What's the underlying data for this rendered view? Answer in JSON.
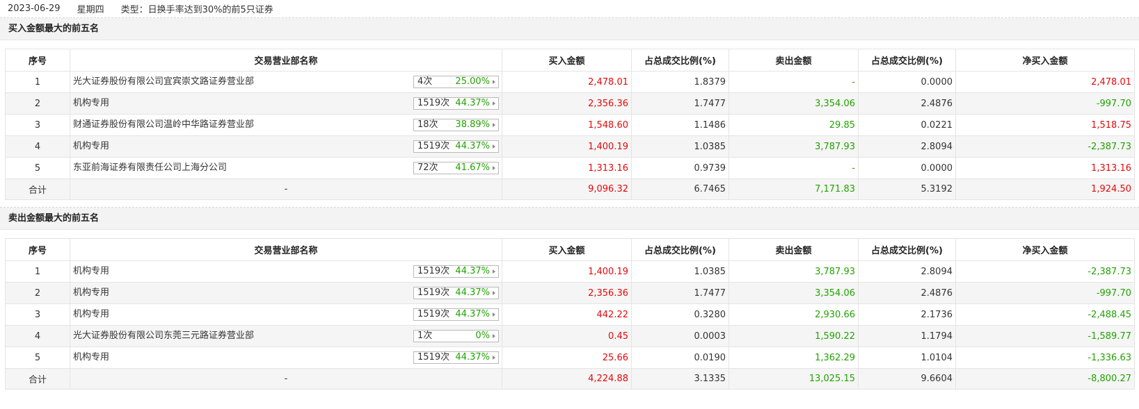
{
  "header": {
    "date": "2023-06-29",
    "weekday": "星期四",
    "type_label": "类型：日换手率达到30%的前5只证券"
  },
  "columns": [
    "序号",
    "交易营业部名称",
    "买入金额",
    "占总成交比例(%)",
    "卖出金额",
    "占总成交比例(%)",
    "净买入金额"
  ],
  "buy_section": {
    "title": "买入金额最大的前五名",
    "rows": [
      {
        "idx": "1",
        "name": "光大证券股份有限公司宜宾崇文路证券营业部",
        "count": "4次",
        "pct": "25.00%",
        "buy": "2,478.01",
        "buy_ratio": "1.8379",
        "sell": "-",
        "sell_ratio": "0.0000",
        "net": "2,478.01",
        "net_dir": "red"
      },
      {
        "idx": "2",
        "name": "机构专用",
        "count": "1519次",
        "pct": "44.37%",
        "buy": "2,356.36",
        "buy_ratio": "1.7477",
        "sell": "3,354.06",
        "sell_ratio": "2.4876",
        "net": "-997.70",
        "net_dir": "green"
      },
      {
        "idx": "3",
        "name": "财通证券股份有限公司温岭中华路证券营业部",
        "count": "18次",
        "pct": "38.89%",
        "buy": "1,548.60",
        "buy_ratio": "1.1486",
        "sell": "29.85",
        "sell_ratio": "0.0221",
        "net": "1,518.75",
        "net_dir": "red"
      },
      {
        "idx": "4",
        "name": "机构专用",
        "count": "1519次",
        "pct": "44.37%",
        "buy": "1,400.19",
        "buy_ratio": "1.0385",
        "sell": "3,787.93",
        "sell_ratio": "2.8094",
        "net": "-2,387.73",
        "net_dir": "green"
      },
      {
        "idx": "5",
        "name": "东亚前海证券有限责任公司上海分公司",
        "count": "72次",
        "pct": "41.67%",
        "buy": "1,313.16",
        "buy_ratio": "0.9739",
        "sell": "-",
        "sell_ratio": "0.0000",
        "net": "1,313.16",
        "net_dir": "red"
      }
    ],
    "total": {
      "label": "合计",
      "name": "-",
      "buy": "9,096.32",
      "buy_ratio": "6.7465",
      "sell": "7,171.83",
      "sell_ratio": "5.3192",
      "net": "1,924.50",
      "net_dir": "red"
    }
  },
  "sell_section": {
    "title": "卖出金额最大的前五名",
    "rows": [
      {
        "idx": "1",
        "name": "机构专用",
        "count": "1519次",
        "pct": "44.37%",
        "buy": "1,400.19",
        "buy_ratio": "1.0385",
        "sell": "3,787.93",
        "sell_ratio": "2.8094",
        "net": "-2,387.73",
        "net_dir": "green"
      },
      {
        "idx": "2",
        "name": "机构专用",
        "count": "1519次",
        "pct": "44.37%",
        "buy": "2,356.36",
        "buy_ratio": "1.7477",
        "sell": "3,354.06",
        "sell_ratio": "2.4876",
        "net": "-997.70",
        "net_dir": "green"
      },
      {
        "idx": "3",
        "name": "机构专用",
        "count": "1519次",
        "pct": "44.37%",
        "buy": "442.22",
        "buy_ratio": "0.3280",
        "sell": "2,930.66",
        "sell_ratio": "2.1736",
        "net": "-2,488.45",
        "net_dir": "green"
      },
      {
        "idx": "4",
        "name": "光大证券股份有限公司东莞三元路证券营业部",
        "count": "1次",
        "pct": "0%",
        "buy": "0.45",
        "buy_ratio": "0.0003",
        "sell": "1,590.22",
        "sell_ratio": "1.1794",
        "net": "-1,589.77",
        "net_dir": "green"
      },
      {
        "idx": "5",
        "name": "机构专用",
        "count": "1519次",
        "pct": "44.37%",
        "buy": "25.66",
        "buy_ratio": "0.0190",
        "sell": "1,362.29",
        "sell_ratio": "1.0104",
        "net": "-1,336.63",
        "net_dir": "green"
      }
    ],
    "total": {
      "label": "合计",
      "name": "-",
      "buy": "4,224.88",
      "buy_ratio": "3.1335",
      "sell": "13,025.15",
      "sell_ratio": "9.6604",
      "net": "-8,800.27",
      "net_dir": "green"
    }
  },
  "colors": {
    "positive": "#e4080a",
    "negative": "#21a200"
  }
}
